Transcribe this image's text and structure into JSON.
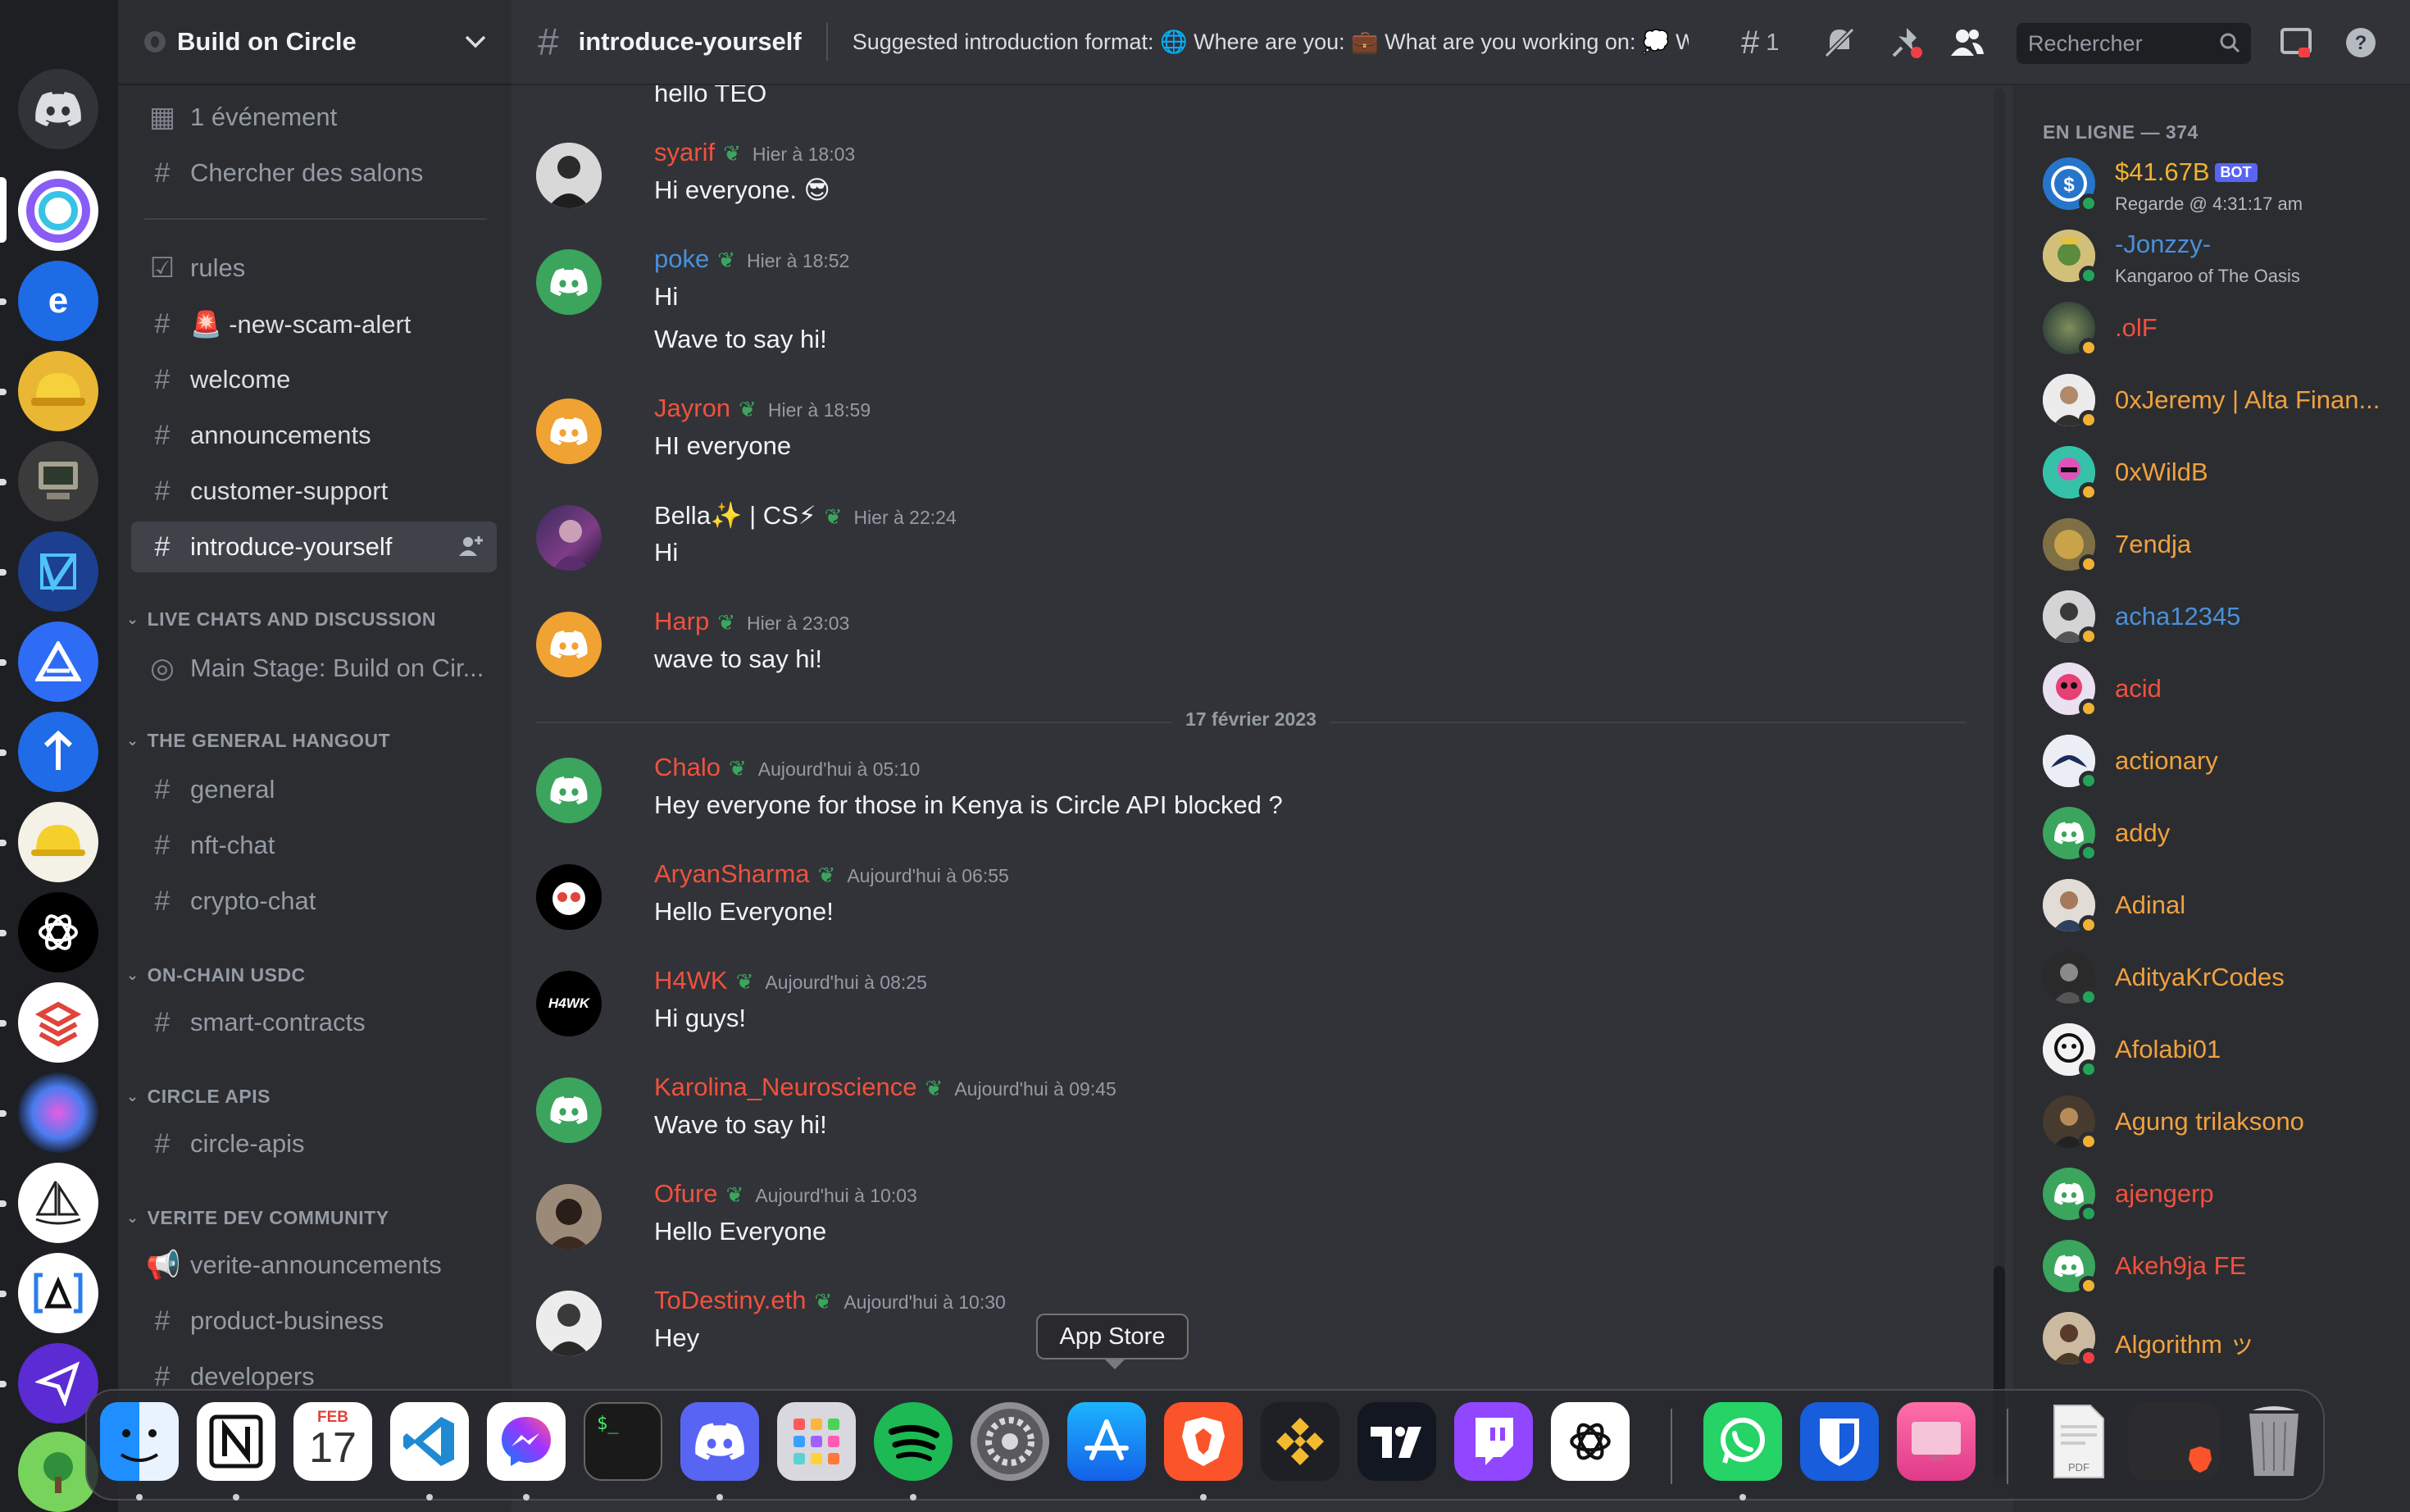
{
  "colors": {
    "accent": "#5865f2",
    "online": "#23a559",
    "idle": "#f0b232",
    "dnd": "#f23f43",
    "name_red": "#f0513e",
    "name_orange": "#f0a13e",
    "name_blue": "#4a90d9"
  },
  "guild_icons": [
    "discord-home-icon",
    "circle-server-icon",
    "e-server-icon",
    "hardhat-server-icon",
    "computer-server-icon",
    "v-server-icon",
    "triangle-server-icon",
    "arrow-server-icon",
    "yellow-hat-server-icon",
    "openai-server-icon",
    "layers-server-icon",
    "siri-server-icon",
    "sailboat-server-icon",
    "bracket-server-icon",
    "send-server-icon",
    "tree-server-icon"
  ],
  "server": {
    "name": "Build on Circle"
  },
  "sidebar": {
    "events": "1 événement",
    "browse": "Chercher des salons",
    "channels_top": [
      "rules",
      "🚨 -new-scam-alert",
      "welcome",
      "announcements",
      "customer-support",
      "introduce-yourself"
    ],
    "categories": {
      "live": "LIVE CHATS AND DISCUSSION",
      "hangout": "THE GENERAL HANGOUT",
      "onchain": "ON-CHAIN USDC",
      "apis": "CIRCLE APIS",
      "verite": "VERITE DEV COMMUNITY"
    },
    "stage": "Main Stage: Build on Cir...",
    "hangout_channels": [
      "general",
      "nft-chat",
      "crypto-chat"
    ],
    "onchain_channels": [
      "smart-contracts"
    ],
    "apis_channels": [
      "circle-apis"
    ],
    "verite_channels": [
      "verite-announcements",
      "product-business",
      "developers"
    ]
  },
  "header": {
    "channel": "introduce-yourself",
    "topic": "Suggested introduction format: 🌐 Where are you: 💼 What are you working on: 💭 W...",
    "threads_count": "1",
    "search_placeholder": "Rechercher"
  },
  "messages": [
    {
      "user": "",
      "time": "",
      "text": "hello TEO",
      "color": "#dbdee1"
    },
    {
      "user": "syarif",
      "time": "Hier à 18:03",
      "text": "Hi everyone. 😎",
      "color": "#f0513e"
    },
    {
      "user": "poke",
      "time": "Hier à 18:52",
      "text": "Hi",
      "text2": "Wave to say hi!",
      "color": "#4a90d9"
    },
    {
      "user": "Jayron",
      "time": "Hier à 18:59",
      "text": "HI everyone",
      "color": "#f0513e"
    },
    {
      "user": "Bella✨ | CS⚡",
      "time": "Hier à 22:24",
      "text": "Hi",
      "color": "#f2f3f5"
    },
    {
      "user": "Harp",
      "time": "Hier à 23:03",
      "text": "wave to say hi!",
      "color": "#f0513e"
    },
    {
      "user": "Chalo",
      "time": "Aujourd'hui à 05:10",
      "text": "Hey everyone for those in Kenya is Circle API blocked ?",
      "color": "#f0513e"
    },
    {
      "user": "AryanSharma",
      "time": "Aujourd'hui à 06:55",
      "text": "Hello Everyone!",
      "color": "#f0513e"
    },
    {
      "user": "H4WK",
      "time": "Aujourd'hui à 08:25",
      "text": "Hi guys!",
      "color": "#f0513e"
    },
    {
      "user": "Karolina_Neuroscience",
      "time": "Aujourd'hui à 09:45",
      "text": "Wave to say hi!",
      "color": "#f0513e"
    },
    {
      "user": "Ofure",
      "time": "Aujourd'hui à 10:03",
      "text": "Hello Everyone",
      "color": "#f0513e"
    },
    {
      "user": "ToDestiny.eth",
      "time": "Aujourd'hui à 10:30",
      "text": "Hey",
      "color": "#f0513e"
    }
  ],
  "date_separator": "17 février 2023",
  "h4wk_avatar_text": "H4WK",
  "members": {
    "heading": "EN LIGNE — 374",
    "list": [
      {
        "name": "$41.67B",
        "bot": "BOT",
        "sub": "Regarde @ 4:31:17 am",
        "color": "#f0b232",
        "status": "online"
      },
      {
        "name": "-Jonzzy-",
        "sub": "Kangaroo of The Oasis",
        "color": "#4a90d9",
        "status": "online"
      },
      {
        "name": ".olF",
        "color": "#f0513e",
        "status": "idle"
      },
      {
        "name": "0xJeremy | Alta Finan...",
        "color": "#f0a13e",
        "status": "idle"
      },
      {
        "name": "0xWildB",
        "color": "#f0a13e",
        "status": "idle"
      },
      {
        "name": "7endja",
        "color": "#f0a13e",
        "status": "idle"
      },
      {
        "name": "acha12345",
        "color": "#4a90d9",
        "status": "idle"
      },
      {
        "name": "acid",
        "color": "#f0513e",
        "status": "idle"
      },
      {
        "name": "actionary",
        "color": "#f0a13e",
        "status": "online"
      },
      {
        "name": "addy",
        "color": "#f0a13e",
        "status": "online"
      },
      {
        "name": "Adinal",
        "color": "#f0a13e",
        "status": "idle"
      },
      {
        "name": "AdityaKrCodes",
        "color": "#f0a13e",
        "status": "online"
      },
      {
        "name": "Afolabi01",
        "color": "#f0a13e",
        "status": "online"
      },
      {
        "name": "Agung trilaksono",
        "color": "#f0a13e",
        "status": "idle"
      },
      {
        "name": "ajengerp",
        "color": "#f0513e",
        "status": "online"
      },
      {
        "name": "Akeh9ja FE",
        "color": "#f0513e",
        "status": "idle"
      },
      {
        "name": "Algorithm ッ",
        "color": "#f0a13e",
        "status": "dnd"
      }
    ]
  },
  "dock": {
    "tooltip": "App Store",
    "calendar_month": "FEB",
    "calendar_day": "17",
    "apps": [
      "finder-icon",
      "notion-icon",
      "calendar-icon",
      "vscode-icon",
      "messenger-icon",
      "terminal-icon",
      "discord-icon",
      "launchpad-icon",
      "spotify-icon",
      "system-settings-icon",
      "app-store-icon",
      "brave-icon",
      "binance-icon",
      "tradingview-icon",
      "twitch-icon",
      "chatgpt-icon",
      "whatsapp-icon",
      "bitwarden-icon",
      "cleanmymac-icon",
      "pdf-document-icon",
      "screenshot-folder-icon",
      "trash-icon"
    ]
  }
}
